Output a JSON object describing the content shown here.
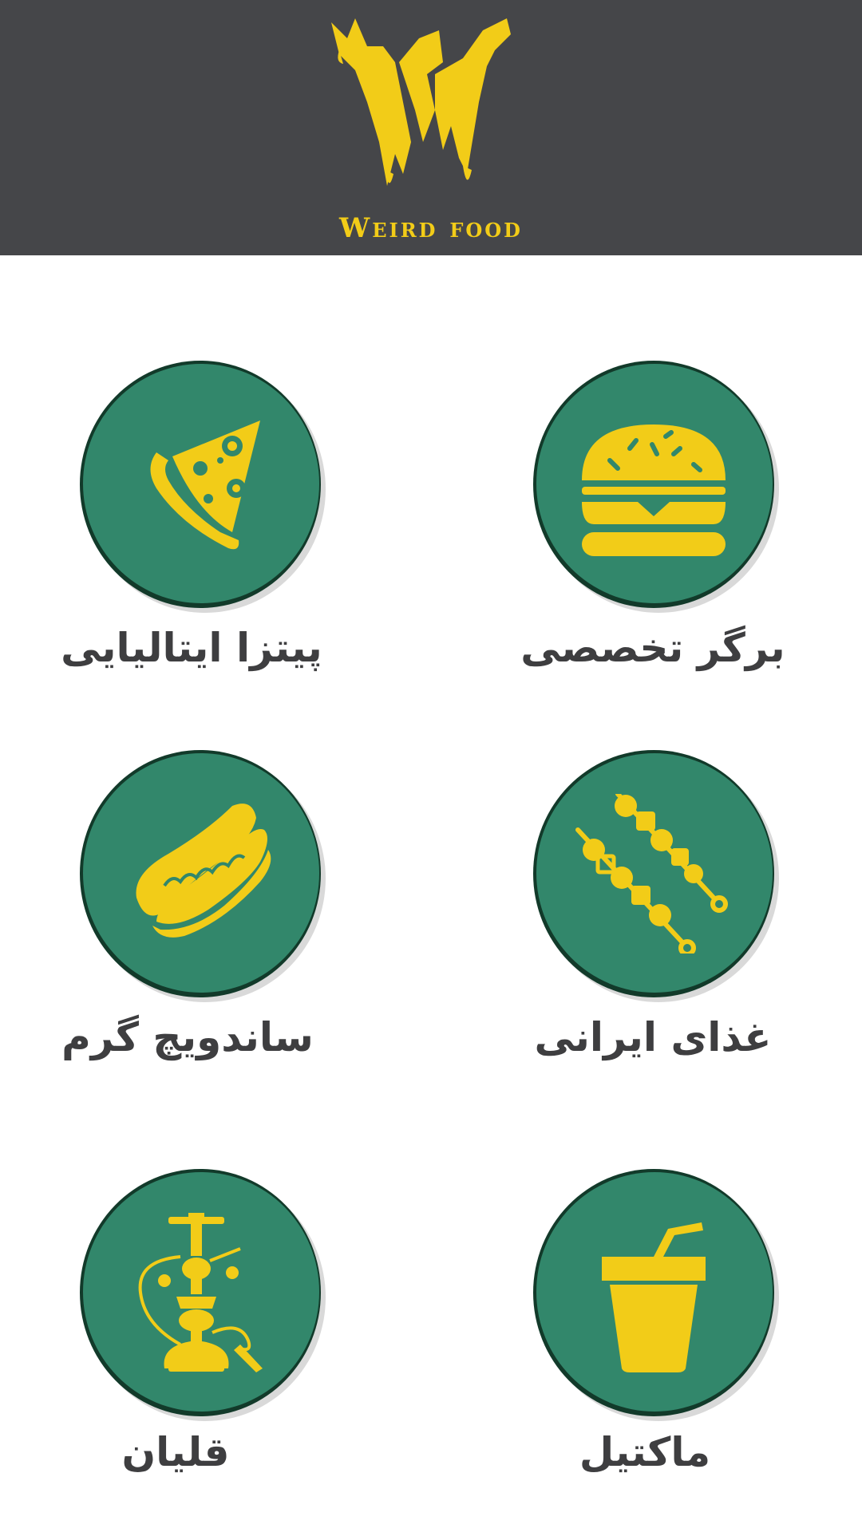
{
  "header": {
    "logo_text": "Weird food",
    "brand_color": "#f2cc18",
    "background_color": "#454649"
  },
  "menu": {
    "accent_color": "#32876b",
    "items": [
      {
        "label": "پیتزا ایتالیایی",
        "icon": "pizza-icon"
      },
      {
        "label": "برگر تخصصی",
        "icon": "burger-icon"
      },
      {
        "label": "ساندویچ گرم",
        "icon": "hotdog-icon"
      },
      {
        "label": "غذای ایرانی",
        "icon": "kebab-icon"
      },
      {
        "label": "قلیان",
        "icon": "hookah-icon"
      },
      {
        "label": "ماکتیل",
        "icon": "drink-cup-icon"
      }
    ]
  }
}
